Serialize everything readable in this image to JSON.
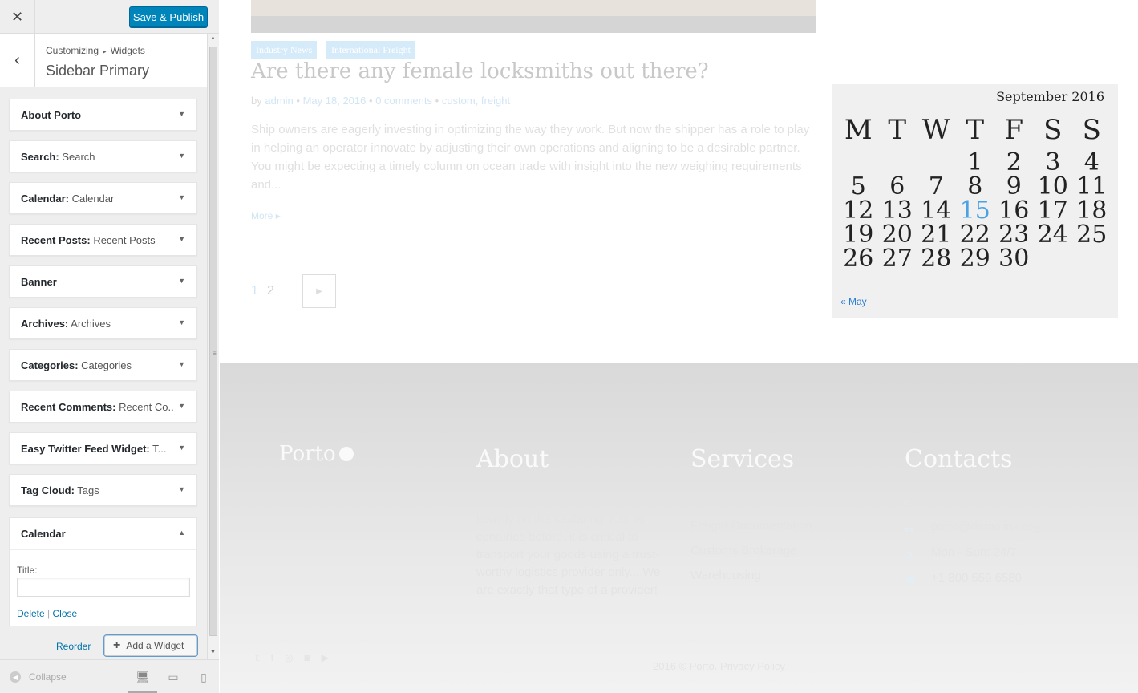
{
  "customizer": {
    "close_icon": "close-icon",
    "save_label": "Save & Publish",
    "breadcrumb": {
      "root": "Customizing",
      "separator": "▸",
      "current": "Widgets"
    },
    "section_title": "Sidebar Primary",
    "widgets": [
      {
        "title": "About Porto",
        "subtitle": ""
      },
      {
        "title": "Search:",
        "subtitle": " Search"
      },
      {
        "title": "Calendar:",
        "subtitle": " Calendar"
      },
      {
        "title": "Recent Posts:",
        "subtitle": " Recent Posts"
      },
      {
        "title": "Banner",
        "subtitle": ""
      },
      {
        "title": "Archives:",
        "subtitle": " Archives"
      },
      {
        "title": "Categories:",
        "subtitle": " Categories"
      },
      {
        "title": "Recent Comments:",
        "subtitle": " Recent Co..."
      },
      {
        "title": "Easy Twitter Feed Widget:",
        "subtitle": " T..."
      },
      {
        "title": "Tag Cloud:",
        "subtitle": " Tags"
      }
    ],
    "open_widget": {
      "title": "Calendar",
      "field_label": "Title:",
      "field_value": "",
      "delete_label": "Delete",
      "divider": "|",
      "close_label": "Close"
    },
    "reorder_label": "Reorder",
    "add_widget_label": "Add a Widget",
    "collapse_label": "Collapse",
    "accent_color": "#0085ba"
  },
  "preview": {
    "categories": [
      "Industry News",
      "International Freight"
    ],
    "post_title": "Are there any female locksmiths out there?",
    "meta": {
      "by": "by",
      "author": "admin",
      "dot": "•",
      "date": "May 18, 2016",
      "comments": "0 comments",
      "tags": "custom, freight"
    },
    "excerpt": "Ship owners are eagerly investing in optimizing the way they work. But now the shipper has a role to play in helping an operator innovate by adjusting their own operations and aligning to be a desirable partner. You might be expecting a timely column on ocean trade with insight into the new weighing requirements and...",
    "more_label": "More",
    "pages": [
      "1",
      "2"
    ],
    "calendar": {
      "caption": "September 2016",
      "weekdays": [
        "M",
        "T",
        "W",
        "T",
        "F",
        "S",
        "S"
      ],
      "weeks": [
        [
          "",
          "",
          "",
          "1",
          "2",
          "3",
          "4"
        ],
        [
          "5",
          "6",
          "7",
          "8",
          "9",
          "10",
          "11"
        ],
        [
          "12",
          "13",
          "14",
          "15",
          "16",
          "17",
          "18"
        ],
        [
          "19",
          "20",
          "21",
          "22",
          "23",
          "24",
          "25"
        ],
        [
          "26",
          "27",
          "28",
          "29",
          "30",
          "",
          ""
        ]
      ],
      "today": "15",
      "prev_label": "« May",
      "today_color": "#4aa1e3"
    },
    "footer": {
      "logo": "Porto",
      "about_heading": "About",
      "about_text": "With the world trade still depending heavily on the seafaring, just as centuries before, it is critical to transport your goods using a trust-worthy logistics provider only... We are exactly that type of a provider!",
      "services_heading": "Services",
      "services": [
        "Sea Freight",
        "Freight Documentation",
        "Customs Brokerage",
        "Warehousing"
      ],
      "contacts_heading": "Contacts",
      "contacts": [
        {
          "icon": "home-icon",
          "text": "22 St. Black Road Raleigh"
        },
        {
          "icon": "monitor-icon",
          "text": "porto@demolink.org"
        },
        {
          "icon": "clock-icon",
          "text": "Mon - Sun: 24/7"
        },
        {
          "icon": "phone-icon",
          "text": "+1 800 559 6580"
        }
      ],
      "copyright": "2016 © Porto. Privacy Policy"
    }
  }
}
